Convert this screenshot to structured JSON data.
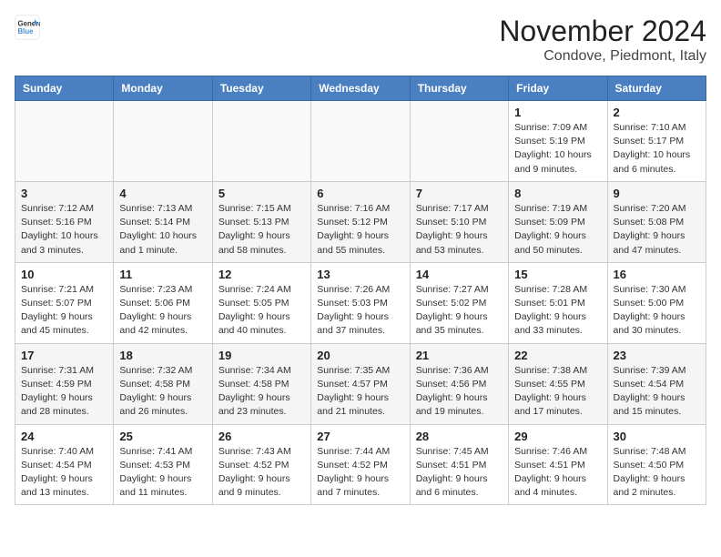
{
  "logo": {
    "line1": "General",
    "line2": "Blue"
  },
  "title": "November 2024",
  "subtitle": "Condove, Piedmont, Italy",
  "headers": [
    "Sunday",
    "Monday",
    "Tuesday",
    "Wednesday",
    "Thursday",
    "Friday",
    "Saturday"
  ],
  "weeks": [
    [
      {
        "day": "",
        "info": ""
      },
      {
        "day": "",
        "info": ""
      },
      {
        "day": "",
        "info": ""
      },
      {
        "day": "",
        "info": ""
      },
      {
        "day": "",
        "info": ""
      },
      {
        "day": "1",
        "info": "Sunrise: 7:09 AM\nSunset: 5:19 PM\nDaylight: 10 hours and 9 minutes."
      },
      {
        "day": "2",
        "info": "Sunrise: 7:10 AM\nSunset: 5:17 PM\nDaylight: 10 hours and 6 minutes."
      }
    ],
    [
      {
        "day": "3",
        "info": "Sunrise: 7:12 AM\nSunset: 5:16 PM\nDaylight: 10 hours and 3 minutes."
      },
      {
        "day": "4",
        "info": "Sunrise: 7:13 AM\nSunset: 5:14 PM\nDaylight: 10 hours and 1 minute."
      },
      {
        "day": "5",
        "info": "Sunrise: 7:15 AM\nSunset: 5:13 PM\nDaylight: 9 hours and 58 minutes."
      },
      {
        "day": "6",
        "info": "Sunrise: 7:16 AM\nSunset: 5:12 PM\nDaylight: 9 hours and 55 minutes."
      },
      {
        "day": "7",
        "info": "Sunrise: 7:17 AM\nSunset: 5:10 PM\nDaylight: 9 hours and 53 minutes."
      },
      {
        "day": "8",
        "info": "Sunrise: 7:19 AM\nSunset: 5:09 PM\nDaylight: 9 hours and 50 minutes."
      },
      {
        "day": "9",
        "info": "Sunrise: 7:20 AM\nSunset: 5:08 PM\nDaylight: 9 hours and 47 minutes."
      }
    ],
    [
      {
        "day": "10",
        "info": "Sunrise: 7:21 AM\nSunset: 5:07 PM\nDaylight: 9 hours and 45 minutes."
      },
      {
        "day": "11",
        "info": "Sunrise: 7:23 AM\nSunset: 5:06 PM\nDaylight: 9 hours and 42 minutes."
      },
      {
        "day": "12",
        "info": "Sunrise: 7:24 AM\nSunset: 5:05 PM\nDaylight: 9 hours and 40 minutes."
      },
      {
        "day": "13",
        "info": "Sunrise: 7:26 AM\nSunset: 5:03 PM\nDaylight: 9 hours and 37 minutes."
      },
      {
        "day": "14",
        "info": "Sunrise: 7:27 AM\nSunset: 5:02 PM\nDaylight: 9 hours and 35 minutes."
      },
      {
        "day": "15",
        "info": "Sunrise: 7:28 AM\nSunset: 5:01 PM\nDaylight: 9 hours and 33 minutes."
      },
      {
        "day": "16",
        "info": "Sunrise: 7:30 AM\nSunset: 5:00 PM\nDaylight: 9 hours and 30 minutes."
      }
    ],
    [
      {
        "day": "17",
        "info": "Sunrise: 7:31 AM\nSunset: 4:59 PM\nDaylight: 9 hours and 28 minutes."
      },
      {
        "day": "18",
        "info": "Sunrise: 7:32 AM\nSunset: 4:58 PM\nDaylight: 9 hours and 26 minutes."
      },
      {
        "day": "19",
        "info": "Sunrise: 7:34 AM\nSunset: 4:58 PM\nDaylight: 9 hours and 23 minutes."
      },
      {
        "day": "20",
        "info": "Sunrise: 7:35 AM\nSunset: 4:57 PM\nDaylight: 9 hours and 21 minutes."
      },
      {
        "day": "21",
        "info": "Sunrise: 7:36 AM\nSunset: 4:56 PM\nDaylight: 9 hours and 19 minutes."
      },
      {
        "day": "22",
        "info": "Sunrise: 7:38 AM\nSunset: 4:55 PM\nDaylight: 9 hours and 17 minutes."
      },
      {
        "day": "23",
        "info": "Sunrise: 7:39 AM\nSunset: 4:54 PM\nDaylight: 9 hours and 15 minutes."
      }
    ],
    [
      {
        "day": "24",
        "info": "Sunrise: 7:40 AM\nSunset: 4:54 PM\nDaylight: 9 hours and 13 minutes."
      },
      {
        "day": "25",
        "info": "Sunrise: 7:41 AM\nSunset: 4:53 PM\nDaylight: 9 hours and 11 minutes."
      },
      {
        "day": "26",
        "info": "Sunrise: 7:43 AM\nSunset: 4:52 PM\nDaylight: 9 hours and 9 minutes."
      },
      {
        "day": "27",
        "info": "Sunrise: 7:44 AM\nSunset: 4:52 PM\nDaylight: 9 hours and 7 minutes."
      },
      {
        "day": "28",
        "info": "Sunrise: 7:45 AM\nSunset: 4:51 PM\nDaylight: 9 hours and 6 minutes."
      },
      {
        "day": "29",
        "info": "Sunrise: 7:46 AM\nSunset: 4:51 PM\nDaylight: 9 hours and 4 minutes."
      },
      {
        "day": "30",
        "info": "Sunrise: 7:48 AM\nSunset: 4:50 PM\nDaylight: 9 hours and 2 minutes."
      }
    ]
  ]
}
